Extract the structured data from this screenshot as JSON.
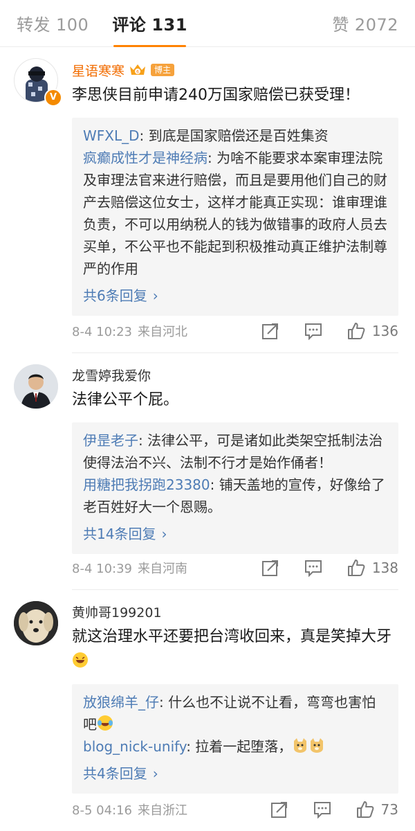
{
  "tabs": {
    "repost": {
      "label": "转发",
      "count": "100"
    },
    "comment": {
      "label": "评论",
      "count": "131"
    },
    "like": {
      "label": "赞",
      "count": "2072"
    }
  },
  "accent_color": "#ff8200",
  "link_color": "#4e7cb5",
  "comments": [
    {
      "username": "星语寒寒",
      "badge": "博主",
      "content": "李思侠目前申请240万国家赔偿已获受理！",
      "replies": [
        {
          "user": "WFXL_D",
          "text": ": 到底是国家赔偿还是百姓集资"
        },
        {
          "user": "疯癫成性才是神经病",
          "text": ": 为啥不能要求本案审理法院及审理法官来进行赔偿，而且是要用他们自己的财产去赔偿这位女士，这样才能真正实现：谁审理谁负责，不可以用纳税人的钱为做错事的政府人员去买单，不公平也不能起到积极推动真正维护法制尊严的作用"
        }
      ],
      "more": "共6条回复",
      "date": "8-4 10:23",
      "from": "来自河北",
      "likes": "136"
    },
    {
      "username": "龙雪婷我爱你",
      "content": "法律公平个屁。",
      "replies": [
        {
          "user": "伊昰老子",
          "text": ": 法律公平，可是诸如此类架空抵制法治使得法治不兴、法制不行才是始作俑者！"
        },
        {
          "user": "用糖把我拐跑23380",
          "text": ": 铺天盖地的宣传，好像给了老百姓好大一个恩赐。"
        }
      ],
      "more": "共14条回复",
      "date": "8-4 10:39",
      "from": "来自河南",
      "likes": "138"
    },
    {
      "username": "黄帅哥199201",
      "content": "就这治理水平还要把台湾收回来，真是笑掉大牙",
      "replies": [
        {
          "user": "放狼绵羊_仔",
          "text": ": 什么也不让说不让看，弯弯也害怕吧"
        },
        {
          "user": "blog_nick-unify",
          "text": ": 拉着一起堕落，"
        }
      ],
      "more": "共4条回复",
      "date": "8-5 04:16",
      "from": "来自浙江",
      "likes": "73"
    }
  ],
  "icons": {
    "share": "share-icon",
    "comment": "comment-icon",
    "like": "thumbs-up-icon",
    "chevron": "chevron-right-icon"
  }
}
